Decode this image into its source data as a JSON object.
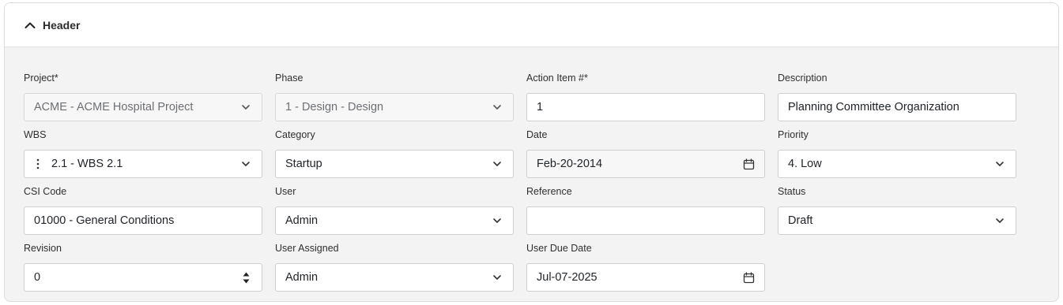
{
  "header": {
    "title": "Header",
    "toggle_icon": "chevron-up-icon"
  },
  "fields": {
    "project": {
      "label": "Project*",
      "value": "ACME - ACME Hospital Project",
      "disabled": true
    },
    "phase": {
      "label": "Phase",
      "value": "1 - Design - Design",
      "disabled": true
    },
    "action_item": {
      "label": "Action Item #*",
      "value": "1"
    },
    "description": {
      "label": "Description",
      "value": "Planning Committee Organization"
    },
    "wbs": {
      "label": "WBS",
      "value": "2.1 - WBS 2.1"
    },
    "category": {
      "label": "Category",
      "value": "Startup"
    },
    "date": {
      "label": "Date",
      "value": "Feb-20-2014"
    },
    "priority": {
      "label": "Priority",
      "value": "4. Low"
    },
    "csi_code": {
      "label": "CSI Code",
      "value": "01000 - General Conditions"
    },
    "user": {
      "label": "User",
      "value": "Admin"
    },
    "reference": {
      "label": "Reference",
      "value": ""
    },
    "status": {
      "label": "Status",
      "value": "Draft"
    },
    "revision": {
      "label": "Revision",
      "value": "0"
    },
    "user_assigned": {
      "label": "User Assigned",
      "value": "Admin"
    },
    "user_due_date": {
      "label": "User Due Date",
      "value": "Jul-07-2025"
    }
  }
}
